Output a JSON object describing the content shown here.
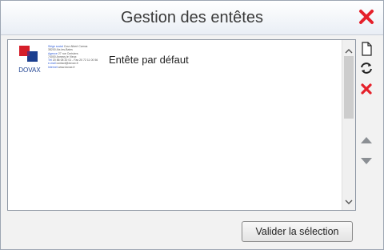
{
  "dialog": {
    "title": "Gestion des entêtes",
    "close_icon": "close-icon"
  },
  "list": {
    "items": [
      {
        "label": "Entête par défaut",
        "logo_text": "DOVAX",
        "meta_lines": [
          {
            "k": "Siège social",
            "v": "Cour Albert Camus"
          },
          {
            "k": "",
            "v": "38200 Aix-les-Bains"
          },
          {
            "k": "Agence",
            "v": "27 rue Cerisiers"
          },
          {
            "k": "",
            "v": "74000 Annecy le Vieux"
          },
          {
            "k": "Tél",
            "v": "20 86 08 20 01 - Fax 20 72 11 00 56"
          },
          {
            "k": "e-mail",
            "v": "contact@dovax.fr"
          },
          {
            "k": "Internet",
            "v": "www.dovax.fr"
          }
        ]
      }
    ]
  },
  "toolbar": {
    "icons": [
      "new-document-icon",
      "refresh-icon",
      "delete-icon",
      "move-up-icon",
      "move-down-icon"
    ]
  },
  "footer": {
    "validate_label": "Valider la sélection"
  },
  "colors": {
    "close": "#e5202a",
    "accent_blue": "#1b3f8f",
    "accent_red": "#d51f2a"
  }
}
